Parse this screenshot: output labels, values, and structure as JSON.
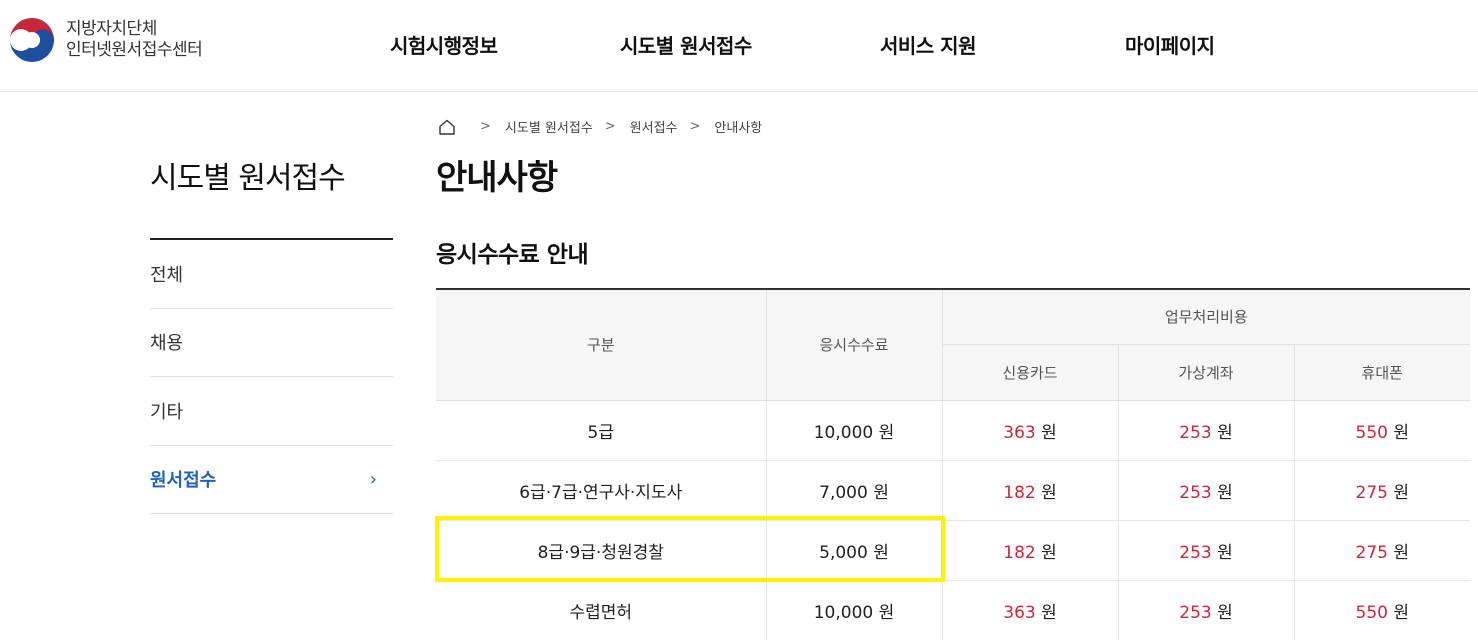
{
  "header": {
    "logo_line1": "지방자치단체",
    "logo_line2": "인터넷원서접수센터",
    "nav": [
      "시험시행정보",
      "시도별 원서접수",
      "서비스 지원",
      "마이페이지"
    ]
  },
  "sidebar": {
    "title": "시도별 원서접수",
    "items": [
      {
        "label": "전체"
      },
      {
        "label": "채용"
      },
      {
        "label": "기타"
      },
      {
        "label": "원서접수",
        "chevron": "›"
      }
    ]
  },
  "breadcrumb": {
    "sep": ">",
    "items": [
      "시도별 원서접수",
      "원서접수",
      "안내사항"
    ]
  },
  "page_title": "안내사항",
  "section_title": "응시수수료 안내",
  "table": {
    "headers": {
      "category": "구분",
      "fee": "응시수수료",
      "processing": "업무처리비용",
      "card": "신용카드",
      "account": "가상계좌",
      "phone": "휴대폰"
    },
    "unit": "원",
    "rows": [
      {
        "category": "5급",
        "fee": "10,000 원",
        "card": "363",
        "account": "253",
        "phone": "550"
      },
      {
        "category": "6급·7급·연구사·지도사",
        "fee": "7,000 원",
        "card": "182",
        "account": "253",
        "phone": "275"
      },
      {
        "category": "8급·9급·청원경찰",
        "fee": "5,000 원",
        "card": "182",
        "account": "253",
        "phone": "275"
      },
      {
        "category": "수렵면허",
        "fee": "10,000 원",
        "card": "363",
        "account": "253",
        "phone": "550"
      }
    ]
  },
  "colors": {
    "accent_blue": "#1e63b8",
    "fee_red": "#c8283a",
    "highlight_yellow": "#fff200"
  }
}
